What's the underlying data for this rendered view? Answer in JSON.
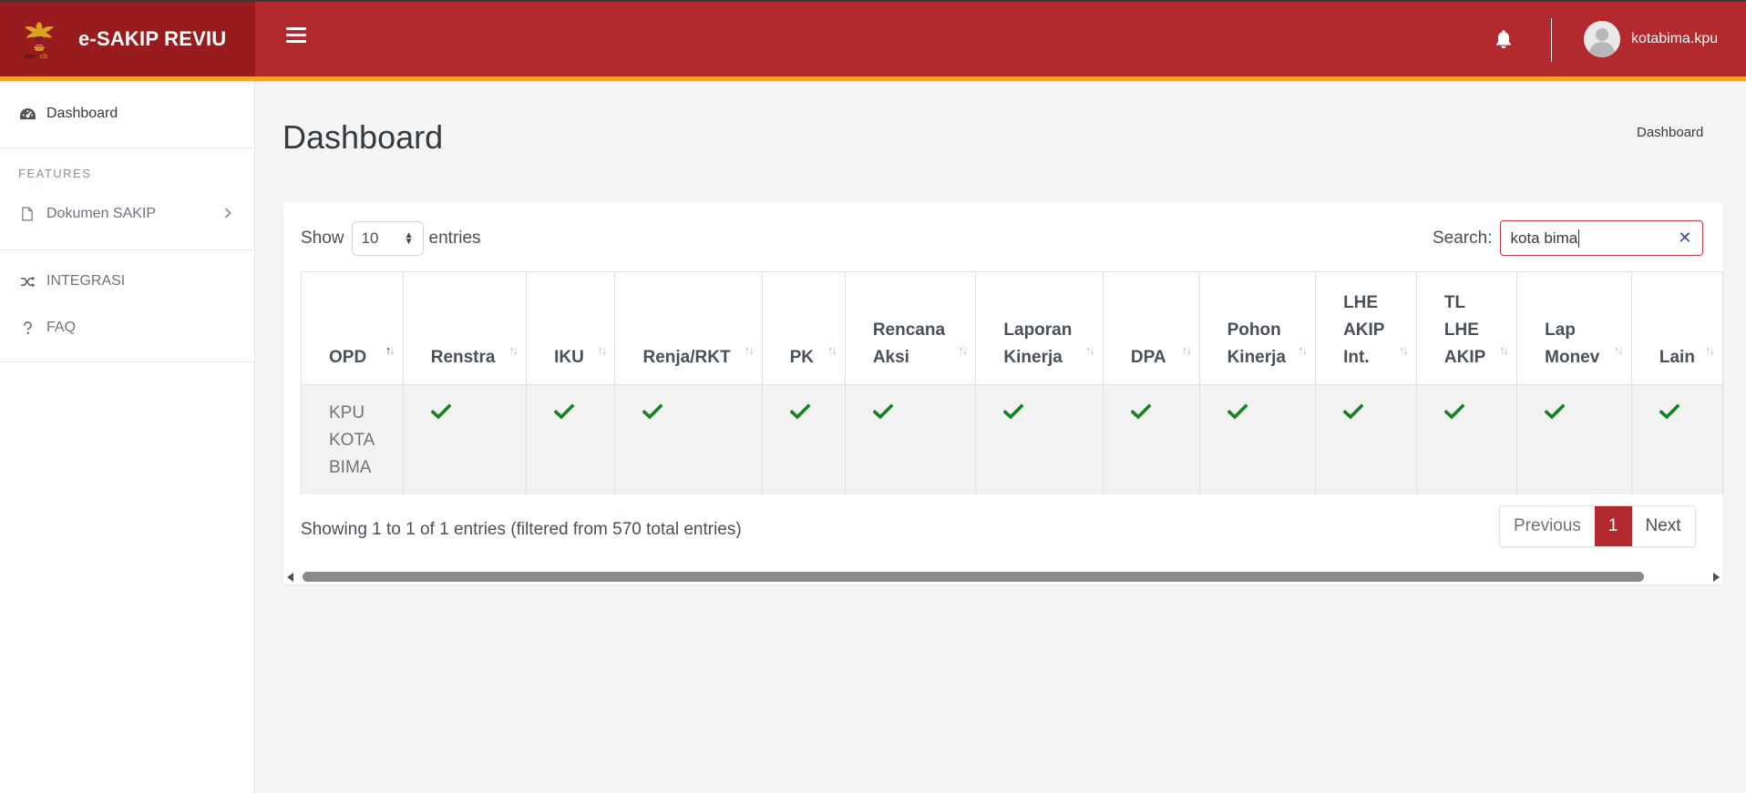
{
  "header": {
    "brand_title": "e-SAKIP REVIU",
    "logo_icon": "garuda-emblem-icon",
    "username": "kotabima.kpu",
    "colors": {
      "topbar": "#b22a2e",
      "brand": "#981b1e",
      "accent_line": "#f6a12b"
    }
  },
  "sidebar": {
    "dashboard": "Dashboard",
    "features_heading": "FEATURES",
    "dokumen": "Dokumen SAKIP",
    "integrasi": "INTEGRASI",
    "faq": "FAQ"
  },
  "page": {
    "title": "Dashboard",
    "breadcrumb": "Dashboard"
  },
  "table_controls": {
    "show_label": "Show",
    "entries_label": "entries",
    "page_size": "10",
    "search_label": "Search:",
    "search_value": "kota bima"
  },
  "table": {
    "columns": [
      [
        "OPD"
      ],
      [
        "Renstra"
      ],
      [
        "IKU"
      ],
      [
        "Renja/RKT"
      ],
      [
        "PK"
      ],
      [
        "Rencana",
        "Aksi"
      ],
      [
        "Laporan",
        "Kinerja"
      ],
      [
        "DPA"
      ],
      [
        "Pohon",
        "Kinerja"
      ],
      [
        "LHE",
        "AKIP",
        "Int."
      ],
      [
        "TL",
        "LHE",
        "AKIP"
      ],
      [
        "Lap",
        "Monev"
      ],
      [
        "Lain"
      ]
    ],
    "rows": [
      {
        "opd": [
          "KPU",
          "KOTA",
          "BIMA"
        ]
      }
    ]
  },
  "footer": {
    "info": "Showing 1 to 1 of 1 entries (filtered from 570 total entries)",
    "prev": "Previous",
    "current_page": "1",
    "next": "Next"
  }
}
